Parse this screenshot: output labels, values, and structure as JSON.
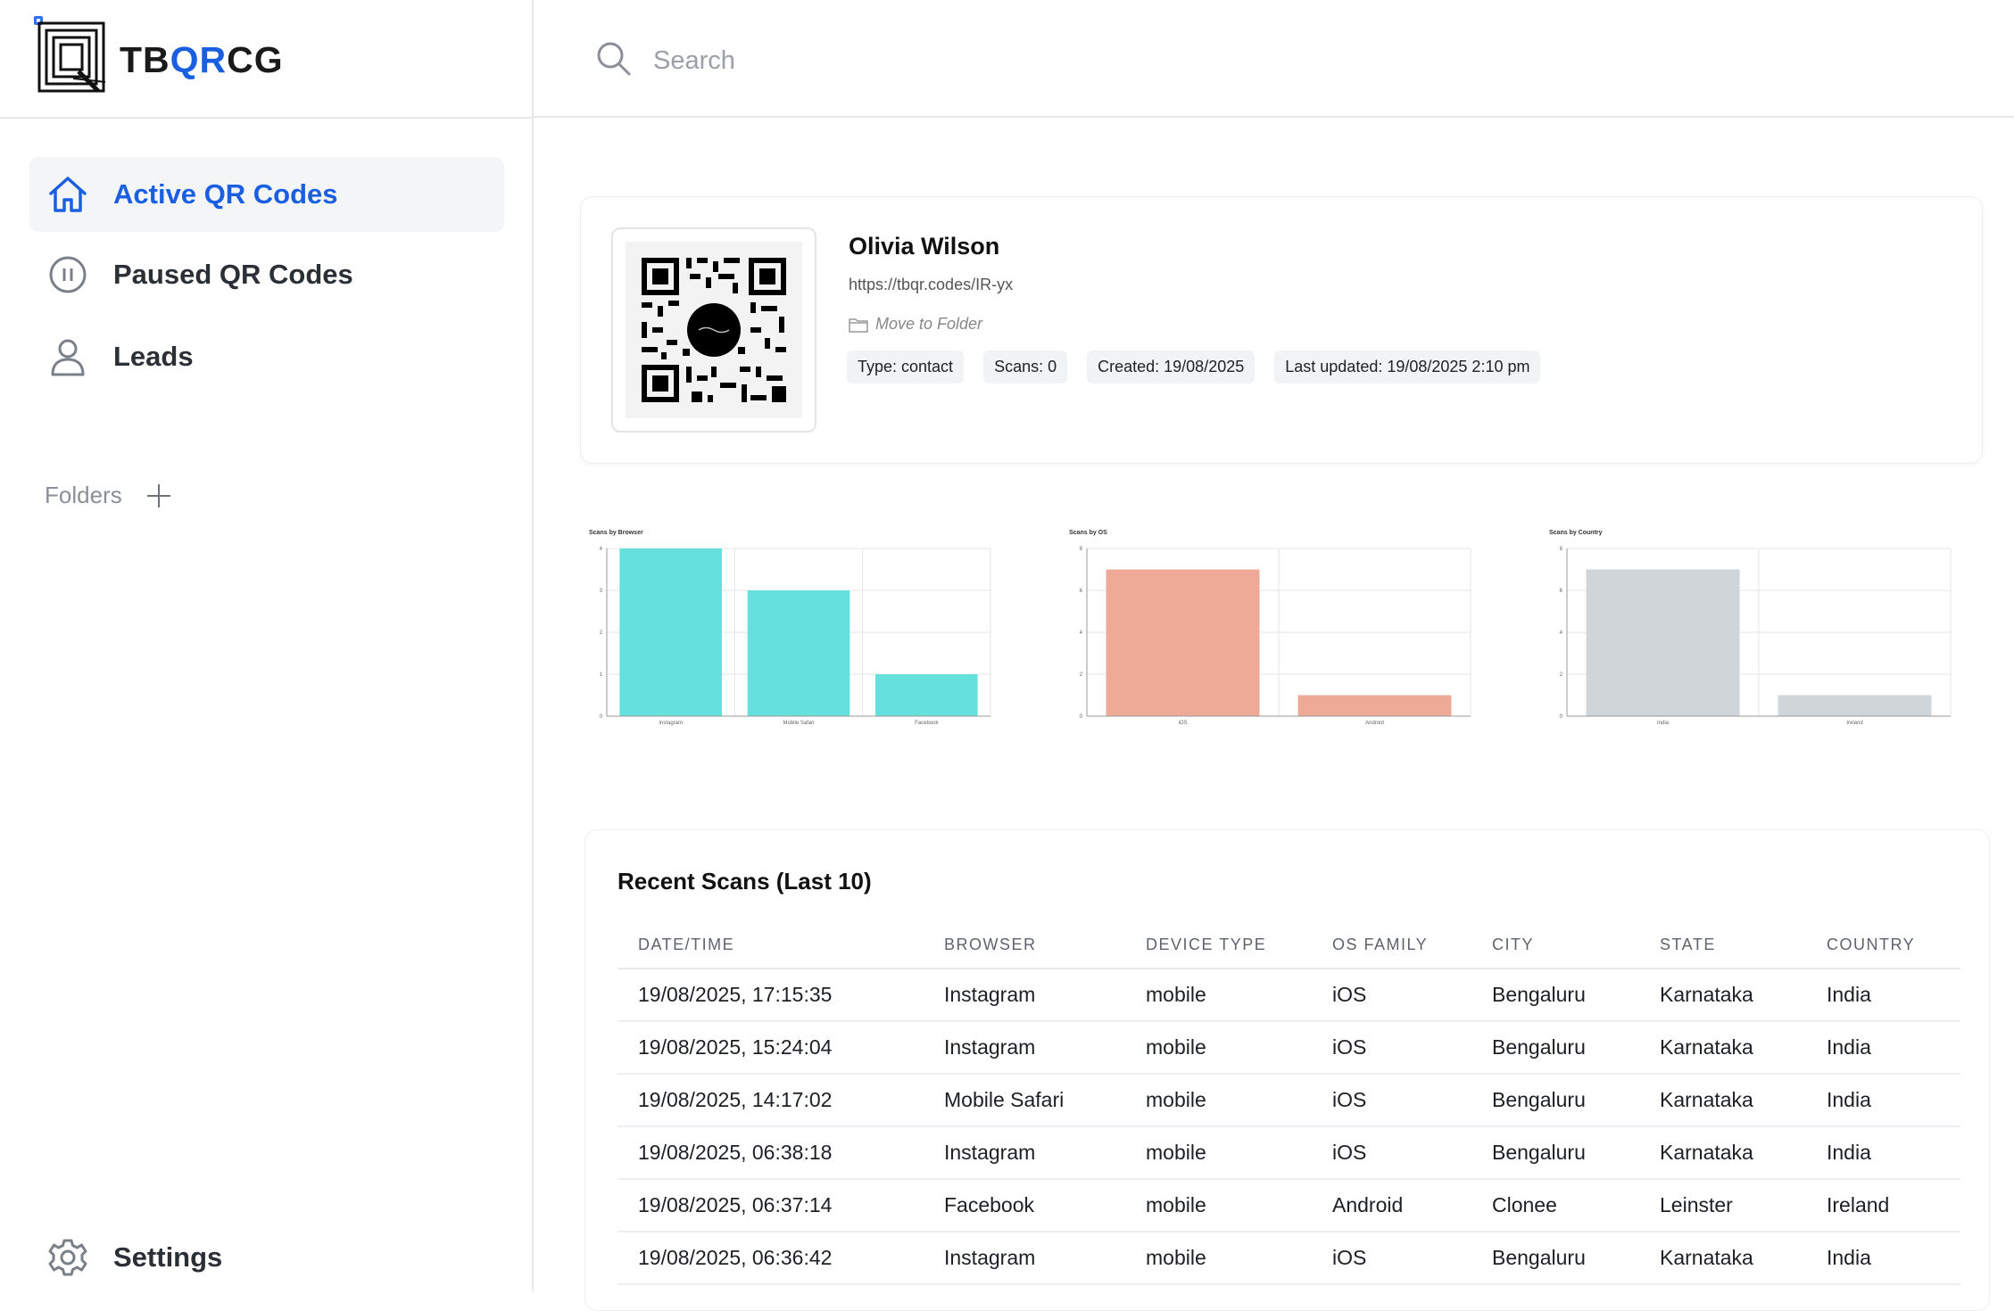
{
  "brand": {
    "prefix": "TB",
    "qr": "QR",
    "suffix": "CG",
    "accent": "#1a5fe0"
  },
  "sidebar": {
    "items": [
      {
        "label": "Active QR Codes",
        "icon": "home-icon",
        "active": true
      },
      {
        "label": "Paused QR Codes",
        "icon": "pause-circle-icon",
        "active": false
      },
      {
        "label": "Leads",
        "icon": "user-icon",
        "active": false
      }
    ],
    "folders_label": "Folders",
    "settings_label": "Settings"
  },
  "search": {
    "placeholder": "Search"
  },
  "qr_card": {
    "title": "Olivia Wilson",
    "url": "https://tbqr.codes/IR-yx",
    "move_to_folder": "Move to Folder",
    "chips": {
      "type": "Type: contact",
      "scans": "Scans: 0",
      "created": "Created: 19/08/2025",
      "updated": "Last updated: 19/08/2025 2:10 pm"
    }
  },
  "chart_data": [
    {
      "type": "bar",
      "title": "Scans by Browser",
      "categories": [
        "Instagram",
        "Mobile Safari",
        "Facebook"
      ],
      "values": [
        4,
        3,
        1
      ],
      "ylim": [
        0,
        4
      ],
      "yticks": [
        0,
        1,
        2,
        3,
        4
      ],
      "color": "#66e0dc",
      "grid": true
    },
    {
      "type": "bar",
      "title": "Scans by OS",
      "categories": [
        "iOS",
        "Android"
      ],
      "values": [
        7,
        1
      ],
      "ylim": [
        0,
        8
      ],
      "yticks": [
        0,
        2,
        4,
        6,
        8
      ],
      "color": "#eea997",
      "grid": true
    },
    {
      "type": "bar",
      "title": "Scans by Country",
      "categories": [
        "India",
        "Ireland"
      ],
      "values": [
        7,
        1
      ],
      "ylim": [
        0,
        8
      ],
      "yticks": [
        0,
        2,
        4,
        6,
        8
      ],
      "color": "#cfd5d9",
      "grid": true
    }
  ],
  "scans": {
    "title": "Recent Scans (Last 10)",
    "columns": [
      "DATE/TIME",
      "BROWSER",
      "DEVICE TYPE",
      "OS FAMILY",
      "CITY",
      "STATE",
      "COUNTRY"
    ],
    "rows": [
      [
        "19/08/2025, 17:15:35",
        "Instagram",
        "mobile",
        "iOS",
        "Bengaluru",
        "Karnataka",
        "India"
      ],
      [
        "19/08/2025, 15:24:04",
        "Instagram",
        "mobile",
        "iOS",
        "Bengaluru",
        "Karnataka",
        "India"
      ],
      [
        "19/08/2025, 14:17:02",
        "Mobile Safari",
        "mobile",
        "iOS",
        "Bengaluru",
        "Karnataka",
        "India"
      ],
      [
        "19/08/2025, 06:38:18",
        "Instagram",
        "mobile",
        "iOS",
        "Bengaluru",
        "Karnataka",
        "India"
      ],
      [
        "19/08/2025, 06:37:14",
        "Facebook",
        "mobile",
        "Android",
        "Clonee",
        "Leinster",
        "Ireland"
      ],
      [
        "19/08/2025, 06:36:42",
        "Instagram",
        "mobile",
        "iOS",
        "Bengaluru",
        "Karnataka",
        "India"
      ]
    ]
  }
}
